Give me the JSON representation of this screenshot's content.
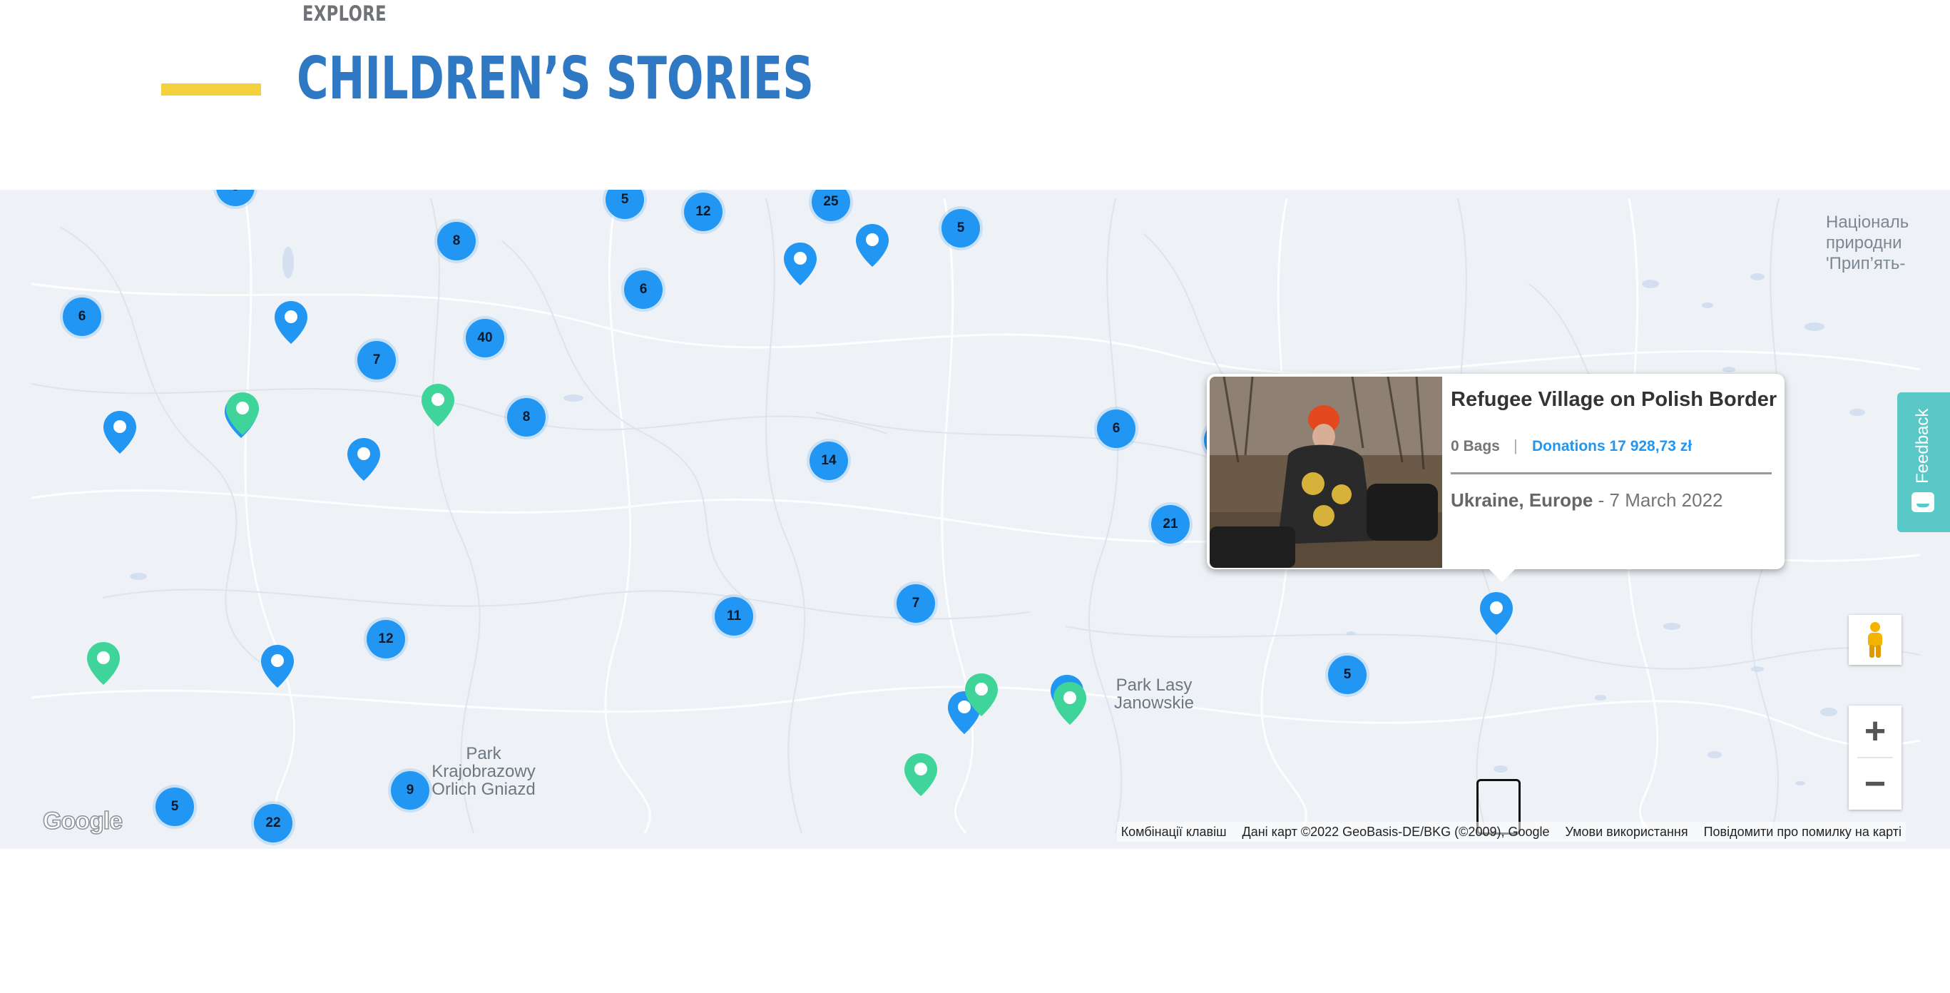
{
  "header": {
    "eyebrow": "EXPLORE",
    "title": "CHILDREN’S STORIES"
  },
  "map": {
    "clusters": [
      "5",
      "12",
      "25",
      "5",
      "8",
      "6",
      "6",
      "40",
      "7",
      "8",
      "14",
      "6",
      "21",
      "11",
      "7",
      "12",
      "9",
      "5",
      "22",
      "5"
    ],
    "place_labels": {
      "park_lasy": "Park Lasy Janowskie",
      "park_krajobrazowy": "Park Krajobrazowy Orlich Gniazd",
      "national_park": "Національ природни 'Прип’ять-"
    },
    "popup": {
      "title": "Refugee Village on Polish Border",
      "bags": "0 Bags",
      "separator": "|",
      "donations": "Donations 17 928,73 zł",
      "location": "Ukraine, Europe",
      "date_separator": " - ",
      "date": "7 March 2022"
    },
    "controls": {
      "zoom_in": "+",
      "zoom_out": "−"
    },
    "attribution": {
      "shortcuts": "Комбінації клавіш",
      "data": "Дані карт ©2022 GeoBasis-DE/BKG (©2009), Google",
      "terms": "Умови використання",
      "report": "Повідомити про помилку на карті"
    },
    "logo": "Google"
  },
  "feedback": {
    "label": "Feedback"
  },
  "colors": {
    "accent_yellow": "#f4d03f",
    "title_blue": "#2f78c4",
    "cluster_blue": "#2196f3",
    "pin_green": "#3fd49a",
    "feedback_teal": "#5bc8c8"
  }
}
